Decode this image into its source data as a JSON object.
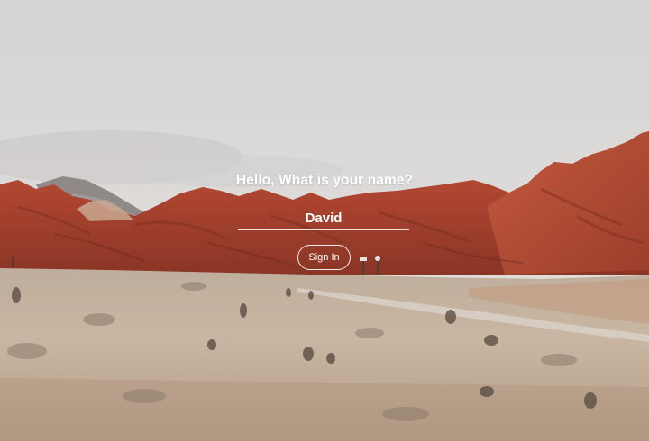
{
  "login": {
    "greeting": "Hello, What is your name?",
    "name_value": "David",
    "sign_in_label": "Sign In"
  },
  "background": {
    "subject": "desert-red-rock-landscape",
    "sky_color": "#d9d8d6",
    "rock_color": "#b8503a",
    "ground_color": "#c8b5a0"
  }
}
